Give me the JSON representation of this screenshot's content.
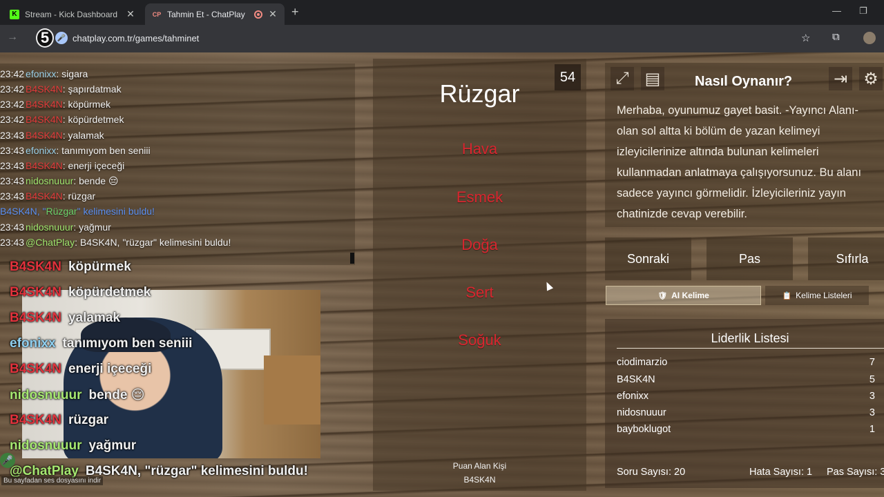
{
  "browser": {
    "tabs": [
      {
        "title": "Stream - Kick Dashboard",
        "favicon": "K"
      },
      {
        "title": "Tahmin Et - ChatPlay",
        "favicon": "CP"
      }
    ],
    "new_tab": "+",
    "url": "chatplay.com.tr/games/tahminet",
    "step_badge": "5"
  },
  "chat": {
    "lines": [
      {
        "time": "23:42",
        "user": "efonixx",
        "color": "grey",
        "msg": ": sigara"
      },
      {
        "time": "23:42",
        "user": "B4SK4N",
        "color": "red",
        "msg": ": şapırdatmak"
      },
      {
        "time": "23:42",
        "user": "B4SK4N",
        "color": "red",
        "msg": ": köpürmek"
      },
      {
        "time": "23:42",
        "user": "B4SK4N",
        "color": "red",
        "msg": ": köpürdetmek"
      },
      {
        "time": "23:43",
        "user": "B4SK4N",
        "color": "red",
        "msg": ": yalamak"
      },
      {
        "time": "23:43",
        "user": "efonixx",
        "color": "grey",
        "msg": ": tanımıyom ben seniii"
      },
      {
        "time": "23:43",
        "user": "B4SK4N",
        "color": "red",
        "msg": ": enerji içeceği"
      },
      {
        "time": "23:43",
        "user": "nidosnuuur",
        "color": "green",
        "msg": ": bende 😔"
      },
      {
        "time": "23:43",
        "user": "B4SK4N",
        "color": "red",
        "msg": ": rüzgar"
      },
      {
        "time": "23:43",
        "user": "nidosnuuur",
        "color": "green",
        "msg": ": yağmur"
      },
      {
        "time": "23:43",
        "user": "@ChatPlay",
        "color": "green",
        "msg": ": B4SK4N, \"rüzgar\" kelimesini buldu!"
      }
    ],
    "system_line": {
      "prefix": "B4SK4N, \"",
      "word": "Rüzgar",
      "suffix": "\" kelimesini buldu!"
    }
  },
  "overlay": {
    "lines": [
      {
        "user": "B4SK4N",
        "color": "red",
        "msg": "köpürmek"
      },
      {
        "user": "B4SK4N",
        "color": "red",
        "msg": "köpürdetmek"
      },
      {
        "user": "B4SK4N",
        "color": "red",
        "msg": "yalamak"
      },
      {
        "user": "efonixx",
        "color": "grey",
        "msg": "tanımıyom ben seniii"
      },
      {
        "user": "B4SK4N",
        "color": "red",
        "msg": "enerji içeceği"
      },
      {
        "user": "nidosnuuur",
        "color": "green",
        "msg": "bende 😔"
      },
      {
        "user": "B4SK4N",
        "color": "red",
        "msg": "rüzgar"
      },
      {
        "user": "nidosnuuur",
        "color": "green",
        "msg": "yağmur"
      },
      {
        "user": "@ChatPlay",
        "color": "green",
        "msg": "B4SK4N, \"rüzgar\" kelimesini buldu!"
      }
    ],
    "download_hint": "Bu sayfadan ses dosyasını indir"
  },
  "game": {
    "timer": "54",
    "word": "Rüzgar",
    "forbidden": [
      "Hava",
      "Esmek",
      "Doğa",
      "Sert",
      "Soğuk"
    ],
    "scorer_label": "Puan Alan Kişi",
    "scorer_name": "B4SK4N"
  },
  "howto": {
    "title": "Nasıl Oynanır?",
    "text": "Merhaba, oyunumuz gayet basit. -Yayıncı Alanı- olan sol altta ki bölüm de yazan kelimeyi izleyicilerinize altında bulunan kelimeleri kullanmadan anlatmaya çalışıyorsunuz. Bu alanı sadece yayıncı görmelidir. İzleyicileriniz yayın chatinizde cevap verebilir."
  },
  "controls": {
    "next": "Sonraki",
    "pass": "Pas",
    "reset": "Sıfırla",
    "ai_word": "AI Kelime",
    "word_lists": "Kelime Listeleri"
  },
  "leaderboard": {
    "title": "Liderlik Listesi",
    "rows": [
      {
        "name": "ciodimarzio",
        "points": "7"
      },
      {
        "name": "B4SK4N",
        "points": "5"
      },
      {
        "name": "efonixx",
        "points": "3"
      },
      {
        "name": "nidosnuuur",
        "points": "3"
      },
      {
        "name": "bayboklugot",
        "points": "1"
      }
    ],
    "question_count": "Soru Sayısı: 20",
    "error_count": "Hata Sayısı: 1",
    "pass_count": "Pas Sayısı: 3"
  }
}
